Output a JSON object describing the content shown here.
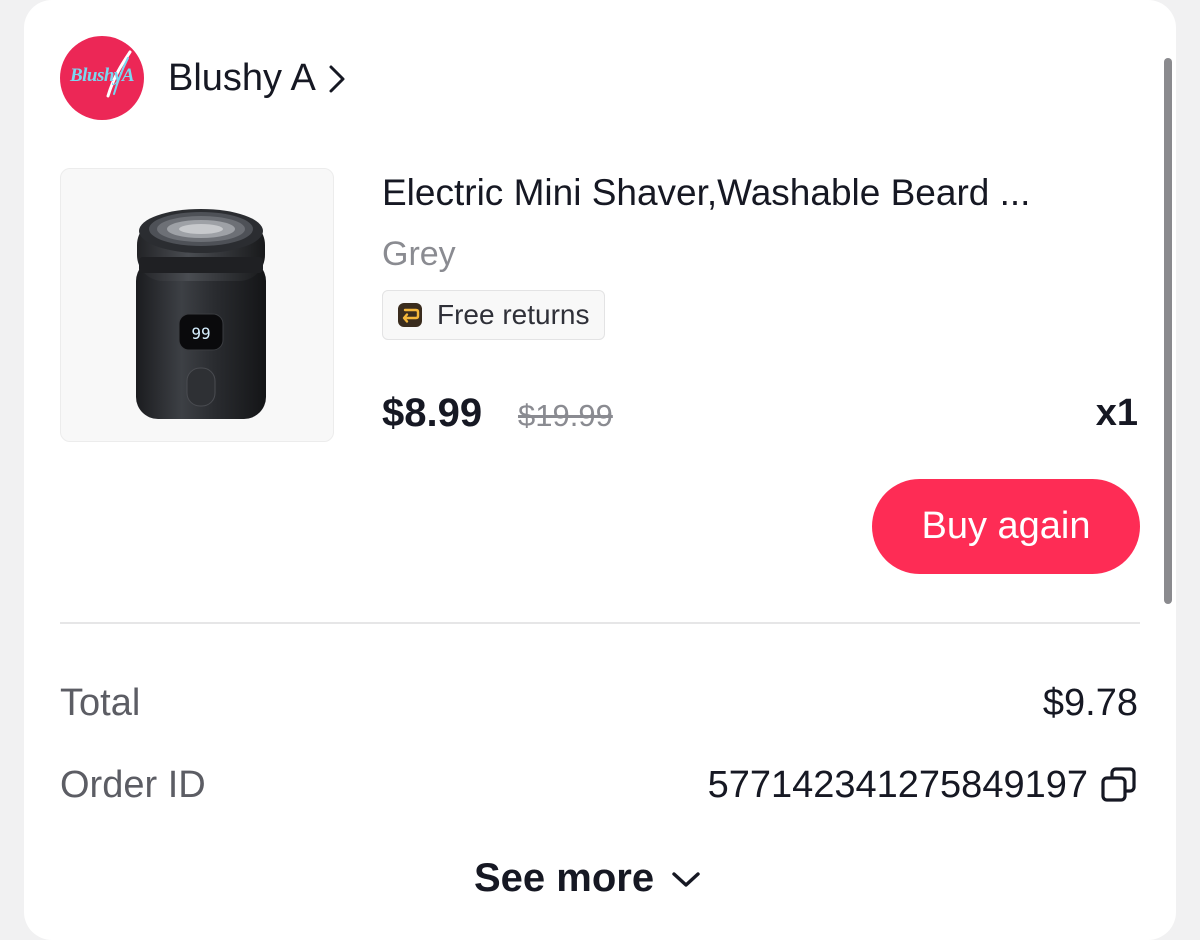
{
  "store": {
    "logo_text": "BlushyA",
    "name": "Blushy A",
    "chevron_icon": "chevron-right-icon"
  },
  "product": {
    "image_icon": "electric-shaver-image",
    "screen_reading": "99",
    "title": "Electric Mini Shaver,Washable Beard ...",
    "variant": "Grey",
    "badge": {
      "icon": "return-arrow-icon",
      "label": "Free returns"
    },
    "price": "$8.99",
    "original_price": "$19.99",
    "quantity": "x1"
  },
  "actions": {
    "buy_again_label": "Buy again"
  },
  "summary": {
    "total_label": "Total",
    "total_value": "$9.78",
    "order_id_label": "Order ID",
    "order_id_value": "577142341275849197",
    "copy_icon": "copy-icon"
  },
  "footer": {
    "see_more_label": "See more",
    "chevron_icon": "chevron-down-icon"
  },
  "colors": {
    "brand": "#fe2c55",
    "logo_background": "#ec2756",
    "text_primary": "#161823",
    "text_secondary": "#8a8b91"
  }
}
